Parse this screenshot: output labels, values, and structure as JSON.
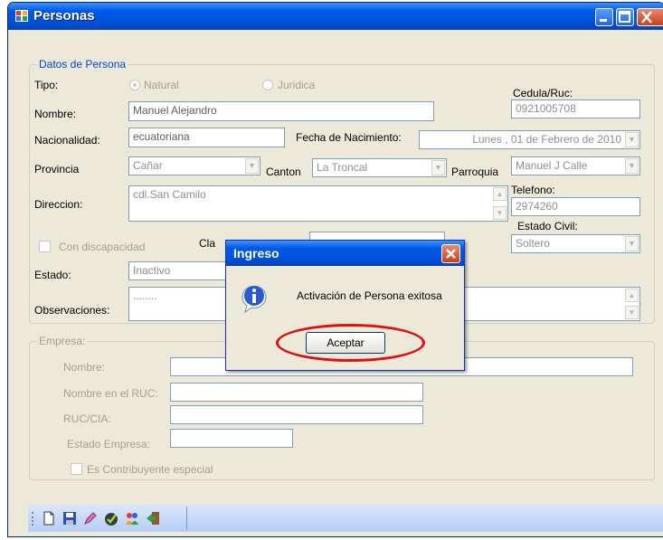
{
  "window": {
    "title": "Personas"
  },
  "datos": {
    "legend": "Datos de Persona",
    "tipo_label": "Tipo:",
    "radio_natural": "Natural",
    "radio_juridica": "Juridica",
    "cedula_label": "Cedula/Ruc:",
    "cedula_value": "0921005708",
    "nombre_label": "Nombre:",
    "nombre_value": "Manuel Alejandro",
    "nacionalidad_label": "Nacionalidad:",
    "nacionalidad_value": "ecuatoriana",
    "fecha_label": "Fecha de Nacimiento:",
    "fecha_value": "Lunes   , 01 de   Febrero   de 2010",
    "provincia_label": "Provincia",
    "provincia_value": "Cañar",
    "canton_label": "Canton",
    "canton_value": "La Troncal",
    "parroquia_label": "Parroquia",
    "parroquia_value": "Manuel J Calle",
    "direccion_label": "Direccion:",
    "direccion_value": "cdl.San Camilo",
    "telefono_label": "Telefono:",
    "telefono_value": "2974260",
    "estado_civil_label": "Estado Civil:",
    "estado_civil_value": "Soltero",
    "discapacidad_label": "Con discapacidad",
    "clave_label": "Cla",
    "estado_label": "Estado:",
    "estado_value": "Inactivo",
    "observaciones_label": "Observaciones:",
    "observaciones_value": "........"
  },
  "empresa": {
    "legend": "Empresa:",
    "nombre_label": "Nombre:",
    "nombre_ruc_label": "Nombre en el RUC:",
    "ruc_label": "RUC/CIA:",
    "estado_label": "Estado Empresa:",
    "contribuyente_label": "Es Contribuyente especial"
  },
  "toolbar": {
    "icons": [
      "new-icon",
      "save-icon",
      "edit-icon",
      "approve-icon",
      "users-icon",
      "exit-icon"
    ]
  },
  "dialog": {
    "title": "Ingreso",
    "message": "Activación de Persona exitosa",
    "ok_label": "Aceptar"
  },
  "colors": {
    "titlebar": "#0058e6",
    "window_bg": "#ece9d8",
    "highlight": "#e01010"
  }
}
